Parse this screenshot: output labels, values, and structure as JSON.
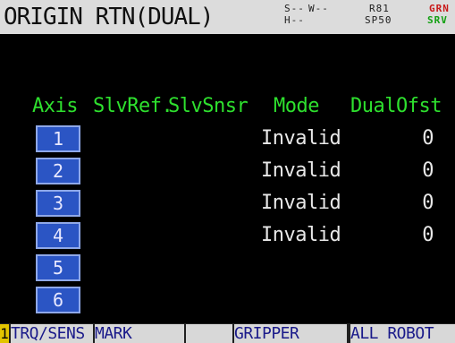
{
  "header": {
    "title": "ORIGIN RTN(DUAL)",
    "status": {
      "s": "S--",
      "w": "W--",
      "h": "H--",
      "r": "R81",
      "sp": "SP50",
      "grn": "GRN",
      "srv": "SRV"
    }
  },
  "table": {
    "columns": [
      "Axis",
      "SlvRef.",
      "SlvSnsr",
      "Mode",
      "DualOfst"
    ],
    "rows": [
      {
        "axis": "1",
        "mode": "Invalid",
        "ofst": "0"
      },
      {
        "axis": "2",
        "mode": "Invalid",
        "ofst": "0"
      },
      {
        "axis": "3",
        "mode": "Invalid",
        "ofst": "0"
      },
      {
        "axis": "4",
        "mode": "Invalid",
        "ofst": "0"
      },
      {
        "axis": "5",
        "mode": "",
        "ofst": ""
      },
      {
        "axis": "6",
        "mode": "",
        "ofst": ""
      }
    ]
  },
  "fkeys": {
    "number": "1",
    "f1": "TRQ/SENS",
    "f2": "MARK",
    "f3": "",
    "f4": "GRIPPER",
    "f5": "ALL ROBOT"
  },
  "colors": {
    "accent_green": "#2ee02e",
    "button_blue": "#2b55c4",
    "status_red": "#c81818"
  }
}
